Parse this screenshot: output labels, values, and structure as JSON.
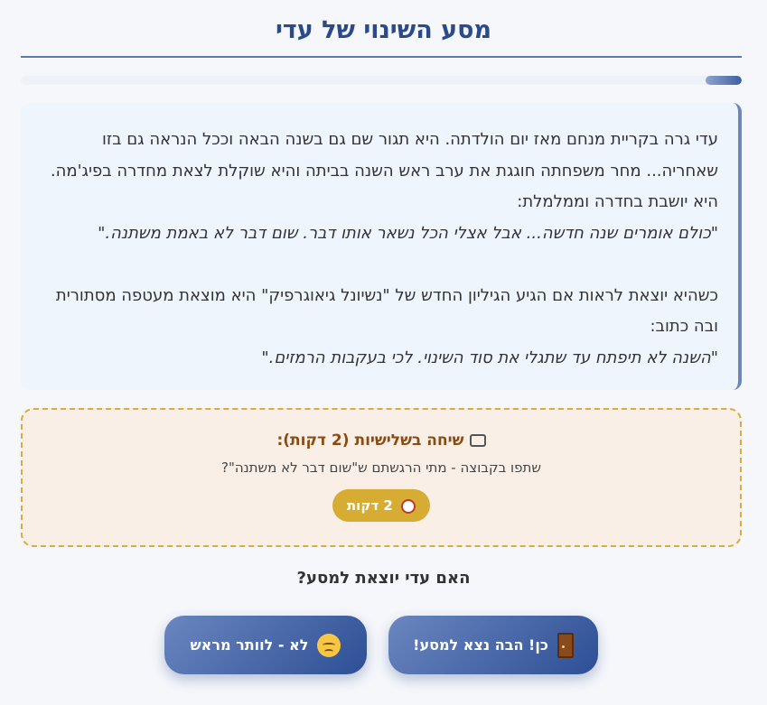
{
  "header": {
    "title": "מסע השינוי של עדי"
  },
  "progress": {
    "fraction": 0.05
  },
  "story": {
    "p1": "עדי גרה בקריית מנחם מאז יום הולדתה. היא תגור שם גם בשנה הבאה וככל הנראה גם בזו שאחריה... מחר משפחתה חוגגת את ערב ראש השנה בביתה והיא שוקלת לצאת מחדרה בפיג'מה. היא יושבת בחדרה וממלמלת:",
    "q1": "\"כולם אומרים שנה חדשה... אבל אצלי הכל נשאר אותו דבר. שום דבר לא באמת משתנה.\"",
    "p2": "כשהיא יוצאת לראות אם הגיע הגיליון החדש של \"נשיונל גיאוגרפיק\" היא מוצאת מעטפה מסתורית ובה כתוב:",
    "q2": "\"השנה לא תיפתח עד שתגלי את סוד השינוי. לכי בעקבות הרמזים.\""
  },
  "discussion": {
    "title": "שיחה בשלישיות (2 דקות):",
    "icon": "speech-bubble-icon",
    "prompt": "שתפו בקבוצה - מתי הרגשתם ש\"שום דבר לא משתנה\"?",
    "timer_label": "2 דקות",
    "timer_icon": "alarm-clock-icon"
  },
  "question": {
    "text": "האם עדי יוצאת למסע?"
  },
  "choices": {
    "yes_label": "כן! הבה נצא למסע!",
    "yes_icon": "door-icon",
    "no_label": "לא - לוותר מראש",
    "no_icon": "pensive-face-icon"
  },
  "colors": {
    "title": "#2b4a8c",
    "accent_gold": "#d7ac32",
    "discussion_title": "#8a4b12",
    "button_gradient_start": "#6b86c0",
    "button_gradient_end": "#2d4f95"
  }
}
